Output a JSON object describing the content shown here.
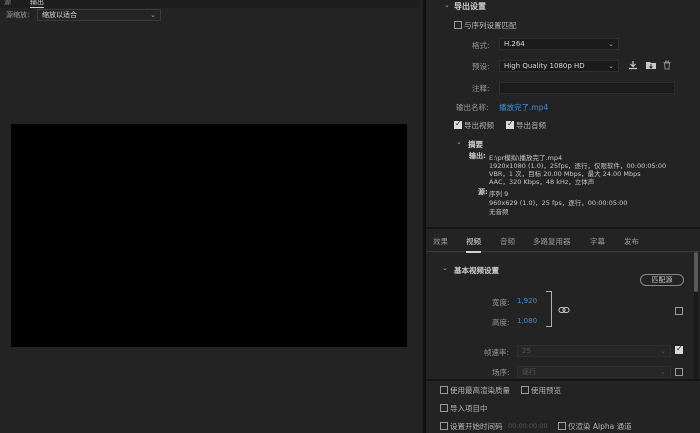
{
  "left_panel": {
    "tabs": [
      "源",
      "输出"
    ],
    "zoom_label": "源缩放:",
    "zoom_value": "缩放以适合"
  },
  "export_settings": {
    "section_title": "导出设置",
    "match_sequence_label": "与序列设置匹配",
    "format_label": "格式:",
    "format_value": "H.264",
    "preset_label": "预设:",
    "preset_value": "High Quality 1080p HD",
    "comments_label": "注释:",
    "output_name_label": "输出名称:",
    "output_name_value": "播放完了.mp4",
    "export_video_label": "导出视频",
    "export_audio_label": "导出音频"
  },
  "summary": {
    "title": "摘要",
    "output_label": "输出:",
    "output_lines": [
      "E:\\pr模拟\\播放完了.mp4",
      "1920x1080 (1.0)，25fps，逐行，仅限软件，00:00:05:00",
      "VBR，1 次，目标 20.00 Mbps，最大 24.00 Mbps",
      "AAC，320 Kbps，48 kHz，立体声"
    ],
    "source_label": "源:",
    "source_lines": [
      "序列 9",
      "960x629 (1.0)，25 fps，逐行，00:00:05:00",
      "无音频"
    ]
  },
  "settings_tabs": [
    "效果",
    "视频",
    "音频",
    "多路复用器",
    "字幕",
    "发布"
  ],
  "active_tab": "视频",
  "basic_video": {
    "title": "基本视频设置",
    "match_source_button": "匹配源",
    "width_label": "宽度:",
    "width_value": "1,920",
    "height_label": "高度:",
    "height_value": "1,080",
    "frame_rate_label": "帧速率:",
    "frame_rate_value": "25",
    "field_order_label": "场序:",
    "field_order_value": "逐行"
  },
  "bottom_options": {
    "max_render_quality": "使用最高渲染质量",
    "use_previews": "使用预览",
    "import_into_project": "导入项目中",
    "set_start_timecode": "设置开始时间码",
    "timecode_value": "00:00:00:00",
    "render_alpha_only": "仅渲染 Alpha 通道"
  },
  "colors": {
    "background": "#232323",
    "link": "#3f8fd8",
    "preview": "#000000"
  }
}
